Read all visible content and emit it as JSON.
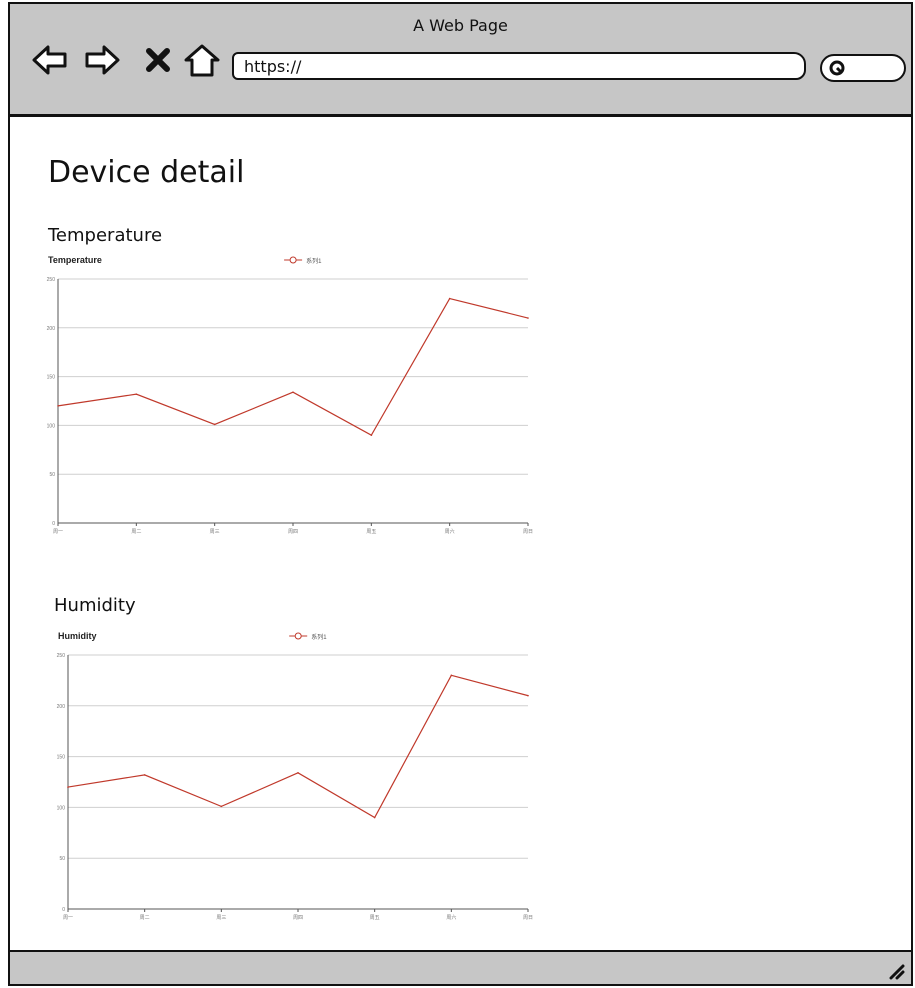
{
  "window": {
    "title": "A Web Page"
  },
  "browser": {
    "url": "https://",
    "icons": [
      "back-arrow-icon",
      "forward-arrow-icon",
      "close-x-icon",
      "home-icon",
      "search-icon"
    ]
  },
  "page": {
    "title": "Device detail"
  },
  "sections": [
    {
      "heading": "Temperature"
    },
    {
      "heading": "Humidity"
    }
  ],
  "colors": {
    "chrome": "#c6c6c6",
    "series_line": "#c0392b",
    "grid": "#cfcfcf"
  },
  "chart_data": [
    {
      "type": "line",
      "title": "Temperature",
      "legend": {
        "placement": "top-center",
        "entries": [
          "系列1"
        ]
      },
      "xlabel": "",
      "ylabel": "",
      "x": [
        "周一",
        "周二",
        "周三",
        "周四",
        "周五",
        "周六",
        "周日"
      ],
      "yticks": [
        "0",
        "50",
        "100",
        "150",
        "200",
        "250"
      ],
      "ylim": [
        0,
        250
      ],
      "grid": true,
      "series": [
        {
          "name": "系列1",
          "values": [
            120,
            132,
            101,
            134,
            90,
            230,
            210
          ]
        }
      ]
    },
    {
      "type": "line",
      "title": "Humidity",
      "legend": {
        "placement": "top-center",
        "entries": [
          "系列1"
        ]
      },
      "xlabel": "",
      "ylabel": "",
      "x": [
        "周一",
        "周二",
        "周三",
        "周四",
        "周五",
        "周六",
        "周日"
      ],
      "yticks": [
        "0",
        "50",
        "100",
        "150",
        "200",
        "250"
      ],
      "ylim": [
        0,
        250
      ],
      "grid": true,
      "series": [
        {
          "name": "系列1",
          "values": [
            120,
            132,
            101,
            134,
            90,
            230,
            210
          ]
        }
      ]
    }
  ]
}
